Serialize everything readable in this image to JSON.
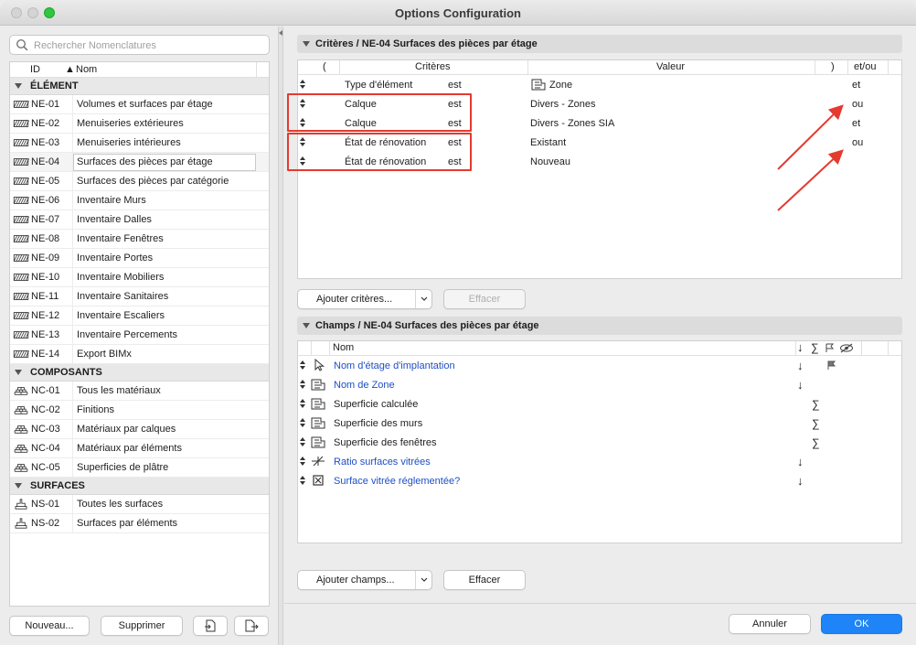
{
  "window": {
    "title": "Options Configuration"
  },
  "search": {
    "placeholder": "Rechercher Nomenclatures"
  },
  "list": {
    "col_id": "ID",
    "col_name": "Nom",
    "groups": [
      {
        "label": "ÉLÉMENT",
        "icon": "hatch-icon",
        "items": [
          {
            "id": "NE-01",
            "name": "Volumes et surfaces par étage"
          },
          {
            "id": "NE-02",
            "name": "Menuiseries extérieures"
          },
          {
            "id": "NE-03",
            "name": "Menuiseries intérieures"
          },
          {
            "id": "NE-04",
            "name": "Surfaces des pièces par étage"
          },
          {
            "id": "NE-05",
            "name": "Surfaces des pièces par catégorie"
          },
          {
            "id": "NE-06",
            "name": "Inventaire Murs"
          },
          {
            "id": "NE-07",
            "name": "Inventaire Dalles"
          },
          {
            "id": "NE-08",
            "name": "Inventaire Fenêtres"
          },
          {
            "id": "NE-09",
            "name": "Inventaire Portes"
          },
          {
            "id": "NE-10",
            "name": "Inventaire Mobiliers"
          },
          {
            "id": "NE-11",
            "name": "Inventaire Sanitaires"
          },
          {
            "id": "NE-12",
            "name": "Inventaire Escaliers"
          },
          {
            "id": "NE-13",
            "name": "Inventaire Percements"
          },
          {
            "id": "NE-14",
            "name": "Export BIMx"
          }
        ]
      },
      {
        "label": "COMPOSANTS",
        "icon": "bricks-icon",
        "items": [
          {
            "id": "NC-01",
            "name": "Tous les matériaux"
          },
          {
            "id": "NC-02",
            "name": "Finitions"
          },
          {
            "id": "NC-03",
            "name": "Matériaux par calques"
          },
          {
            "id": "NC-04",
            "name": "Matériaux par éléments"
          },
          {
            "id": "NC-05",
            "name": "Superficies de plâtre"
          }
        ]
      },
      {
        "label": "SURFACES",
        "icon": "brush-icon",
        "items": [
          {
            "id": "NS-01",
            "name": "Toutes les surfaces"
          },
          {
            "id": "NS-02",
            "name": "Surfaces par éléments"
          }
        ]
      }
    ],
    "selected": "NE-04"
  },
  "left_buttons": {
    "new": "Nouveau...",
    "delete": "Supprimer"
  },
  "criteria": {
    "title": "Critères / NE-04 Surfaces des pièces par étage",
    "headers": {
      "open": "(",
      "criteria": "Critères",
      "value": "Valeur",
      "close": ")",
      "andor": "et/ou"
    },
    "rows": [
      {
        "criterion": "Type d'élément",
        "op": "est",
        "value": "Zone",
        "andor": "et"
      },
      {
        "criterion": "Calque",
        "op": "est",
        "value": "Divers - Zones",
        "andor": "ou"
      },
      {
        "criterion": "Calque",
        "op": "est",
        "value": "Divers - Zones SIA",
        "andor": "et"
      },
      {
        "criterion": "État de rénovation",
        "op": "est",
        "value": "Existant",
        "andor": "ou"
      },
      {
        "criterion": "État de rénovation",
        "op": "est",
        "value": "Nouveau",
        "andor": ""
      }
    ],
    "add_label": "Ajouter critères...",
    "clear_label": "Effacer"
  },
  "fields": {
    "title": "Champs / NE-04 Surfaces des pièces par étage",
    "headers": {
      "name": "Nom",
      "sort": "↓",
      "sum": "∑"
    },
    "rows": [
      {
        "name": "Nom d'étage d'implantation",
        "icon": "pointer-icon",
        "blue": true,
        "sort": "↓",
        "sum": ""
      },
      {
        "name": "Nom de Zone",
        "icon": "zone-icon",
        "blue": true,
        "sort": "↓",
        "sum": ""
      },
      {
        "name": "Superficie calculée",
        "icon": "zone-icon",
        "blue": false,
        "sort": "",
        "sum": "∑"
      },
      {
        "name": "Superficie des murs",
        "icon": "zone-icon",
        "blue": false,
        "sort": "",
        "sum": "∑"
      },
      {
        "name": "Superficie des fenêtres",
        "icon": "zone-icon",
        "blue": false,
        "sort": "",
        "sum": "∑"
      },
      {
        "name": "Ratio surfaces vitrées",
        "icon": "ratio-icon",
        "blue": true,
        "sort": "↓",
        "sum": ""
      },
      {
        "name": "Surface vitrée réglementée?",
        "icon": "checkbox-icon",
        "blue": true,
        "sort": "↓",
        "sum": ""
      }
    ],
    "add_label": "Ajouter champs...",
    "clear_label": "Effacer"
  },
  "footer": {
    "cancel": "Annuler",
    "ok": "OK"
  },
  "colors": {
    "accent": "#1e84f8",
    "annotation": "#e53a2f",
    "link_blue": "#1f4fc4"
  }
}
